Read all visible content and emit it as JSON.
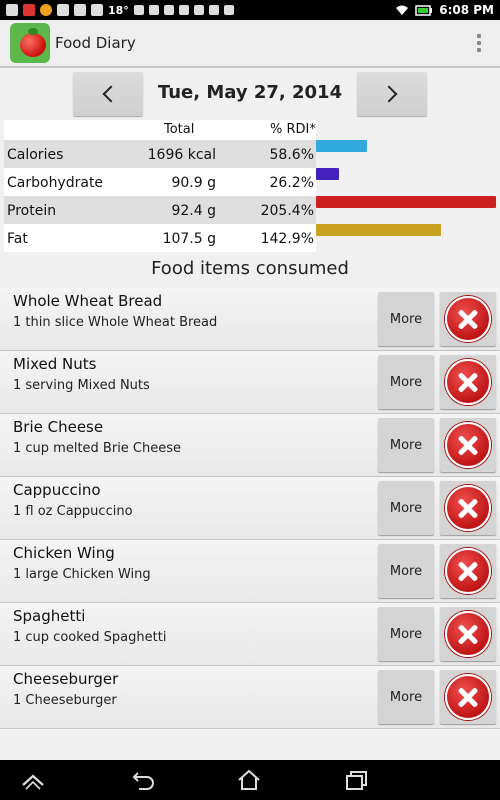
{
  "status_bar": {
    "temperature": "18°",
    "time": "6:08 PM"
  },
  "app": {
    "title": "Food Diary"
  },
  "date_nav": {
    "date": "Tue, May 27, 2014"
  },
  "nutrients": {
    "header_total": "Total",
    "header_rdi": "% RDI*",
    "rows": [
      {
        "name": "Calories",
        "total": "1696 kcal",
        "rdi": "58.6%",
        "rdi_value": 58.6,
        "bar_color": "#33aadd"
      },
      {
        "name": "Carbohydrate",
        "total": "90.9 g",
        "rdi": "26.2%",
        "rdi_value": 26.2,
        "bar_color": "#4422bb"
      },
      {
        "name": "Protein",
        "total": "92.4 g",
        "rdi": "205.4%",
        "rdi_value": 205.4,
        "bar_color": "#cc1f1f"
      },
      {
        "name": "Fat",
        "total": "107.5 g",
        "rdi": "142.9%",
        "rdi_value": 142.9,
        "bar_color": "#c9a020"
      }
    ]
  },
  "food_section": {
    "title": "Food items consumed",
    "more_label": "More",
    "items": [
      {
        "name": "Whole Wheat Bread",
        "serving": "1 thin slice Whole Wheat Bread"
      },
      {
        "name": "Mixed Nuts",
        "serving": "1 serving Mixed Nuts"
      },
      {
        "name": "Brie Cheese",
        "serving": "1 cup melted Brie Cheese"
      },
      {
        "name": "Cappuccino",
        "serving": "1 fl oz Cappuccino"
      },
      {
        "name": "Chicken Wing",
        "serving": "1 large Chicken Wing"
      },
      {
        "name": "Spaghetti",
        "serving": "1 cup cooked Spaghetti"
      },
      {
        "name": "Cheeseburger",
        "serving": "1 Cheeseburger"
      }
    ]
  }
}
